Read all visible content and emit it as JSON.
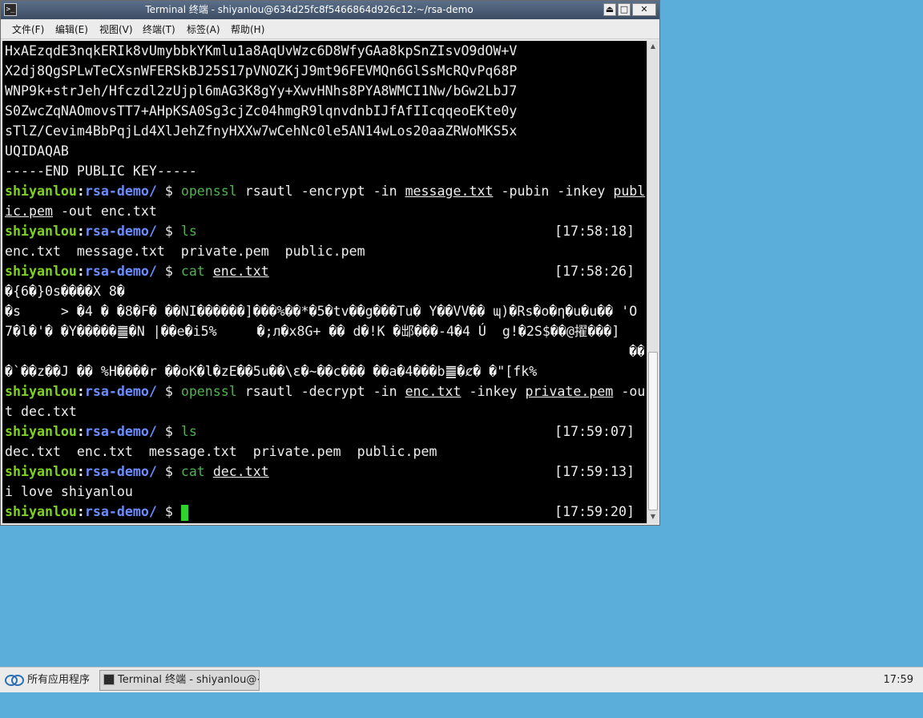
{
  "window": {
    "title": "Terminal 终端 - shiyanlou@634d25fc8f5466864d926c12:~/rsa-demo",
    "icon": "terminal-icon",
    "controls": {
      "shade": "⏏",
      "maximize": "□",
      "close": "✕"
    }
  },
  "menubar": {
    "items": [
      {
        "label": "文件(F)"
      },
      {
        "label": "编辑(E)"
      },
      {
        "label": "视图(V)"
      },
      {
        "label": "终端(T)"
      },
      {
        "label": "标签(A)"
      },
      {
        "label": "帮助(H)"
      }
    ]
  },
  "terminal": {
    "prompt": {
      "user": "shiyanlou",
      "colon": ":",
      "dir": "rsa-demo/",
      "dollar": " $ "
    },
    "key_lines": [
      "HxAEzqdE3nqkERIk8vUmybbkYKmlu1a8AqUvWzc6D8WfyGAa8kpSnZIsvO9dOW+V",
      "X2dj8QgSPLwTeCXsnWFERSkBJ25S17pVNOZKjJ9mt96FEVMQn6GlSsMcRQvPq68P",
      "WNP9k+strJeh/Hfczdl2zUjpl6mAG3K8gYy+XwvHNhs8PYA8WMCI1Nw/bGw2LbJ7",
      "S0ZwcZqNAOmovsTT7+AHpKSA0Sg3cjZc04hmgR9lqnvdnbIJfAfIIcqqeoEKte0y",
      "sTlZ/Cevim4BbPqjLd4XlJehZfnyHXXw7wCehNc0le5AN14wLos20aaZRWoMKS5x",
      "UQIDAQAB",
      "-----END PUBLIC KEY-----"
    ],
    "cmd_encrypt": {
      "prog": "openssl",
      "t1": " rsautl -encrypt -in ",
      "f1": "message.txt",
      "t2": " -pubin -inkey ",
      "f2a": "publ",
      "f2b": "ic.pem",
      "t3": " -out enc.txt"
    },
    "cmd_ls1": {
      "prog": "ls",
      "time": "[17:58:18]"
    },
    "out_ls1": "enc.txt  message.txt  private.pem  public.pem",
    "cmd_cat1": {
      "prog": "cat",
      "file": "enc.txt",
      "time": "[17:58:26]"
    },
    "binary_lines": [
      "�{6�}0s����X 8�",
      "�s     > �4 � �8�F� ��NI������]���%��*�5�tv��g���Tu� Y��VV�� ɰ)�Rs�o�η�u�u�� 'O",
      "7�l�'� �Y�����䷀�N |��e�i5%     �;л�x8G+ �� d�!K �䢺���-4�4 Ú  g!�2S$��@擢���]",
      "                                                                              ��",
      "�`��z��J �� %H����r ��oK�l�zE��5u��\\ε�~��c��� ��a�4���b䷀�ȼ� �\"[fk%"
    ],
    "cmd_decrypt": {
      "prog": "openssl",
      "t1": " rsautl -decrypt -in ",
      "f1": "enc.txt",
      "t2": " -inkey ",
      "f2": "private.pem",
      "t3": " -ou",
      "t4": "t dec.txt"
    },
    "cmd_ls2": {
      "prog": "ls",
      "time": "[17:59:07]"
    },
    "out_ls2": "dec.txt  enc.txt  message.txt  private.pem  public.pem",
    "cmd_cat2": {
      "prog": "cat",
      "file": "dec.txt",
      "time": "[17:59:13]"
    },
    "out_cat2": "i love shiyanlou",
    "cmd_final": {
      "time": "[17:59:20]"
    }
  },
  "taskbar": {
    "start_label": "所有应用程序",
    "task_label": "Terminal 终端 - shiyanlou@⋯",
    "clock": "17:59"
  }
}
